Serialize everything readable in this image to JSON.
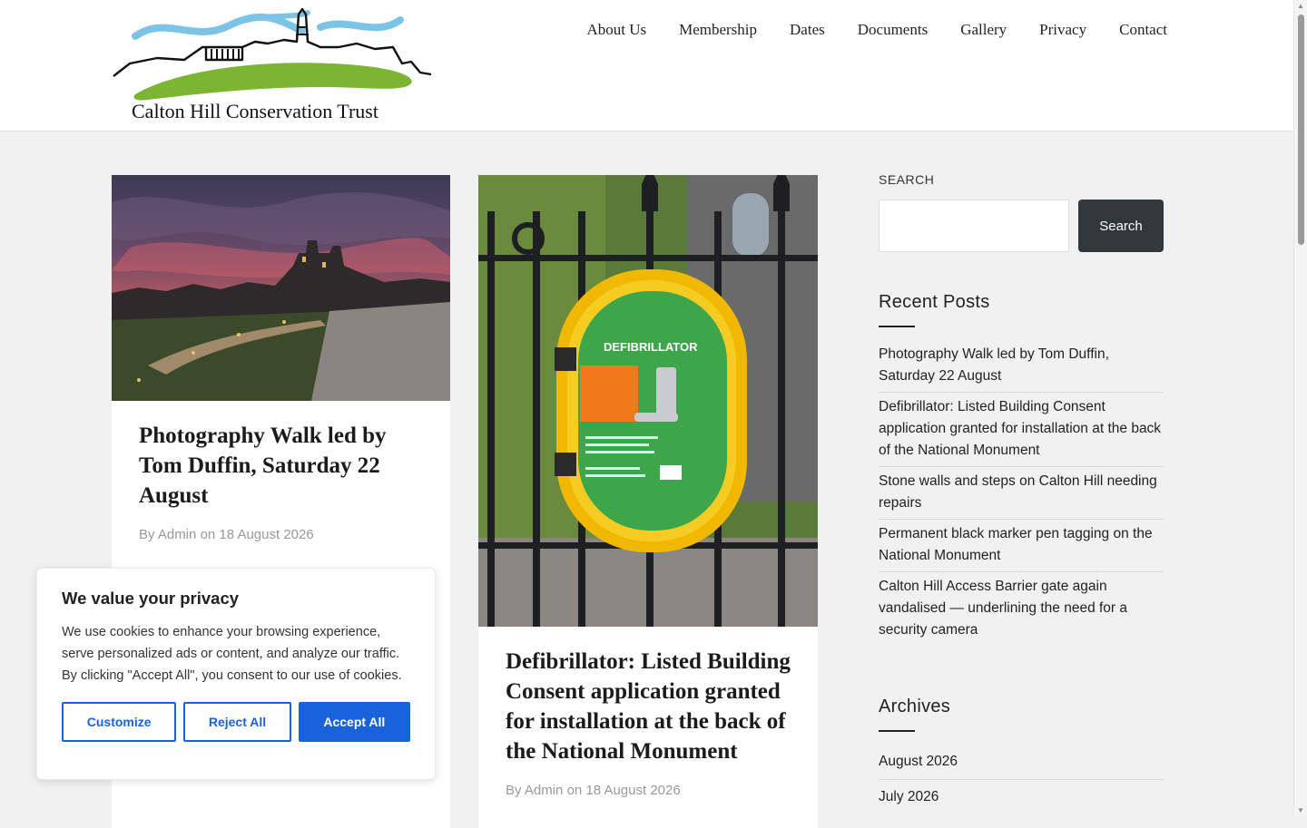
{
  "header": {
    "logo_text": "Calton Hill Conservation Trust",
    "nav": [
      {
        "label": "About Us"
      },
      {
        "label": "Membership"
      },
      {
        "label": "Dates"
      },
      {
        "label": "Documents"
      },
      {
        "label": "Gallery"
      },
      {
        "label": "Privacy"
      },
      {
        "label": "Contact"
      }
    ]
  },
  "posts": [
    {
      "title": "Photography Walk led by Tom Duffin, Saturday 22 August",
      "meta_by": "By",
      "author": "Admin",
      "meta_on": "on",
      "date": "18 August 2026",
      "image": "sunset-calton-hill-photo"
    },
    {
      "title": "Defibrillator: Listed Building Consent application granted for installation at the back of the National Monument",
      "meta_by": "By",
      "author": "Admin",
      "meta_on": "on",
      "date": "18 August 2026",
      "image": "defibrillator-on-railings-photo",
      "image_label": "DEFIBRILLATOR"
    }
  ],
  "sidebar": {
    "search": {
      "label": "SEARCH",
      "placeholder": "",
      "button_label": "Search"
    },
    "recent_posts": {
      "title": "Recent Posts",
      "items": [
        "Photography Walk led by Tom Duffin, Saturday 22 August",
        "Defibrillator: Listed Building Consent application granted for installation at the back of the National Monument",
        "Stone walls and steps on Calton Hill needing repairs",
        "Permanent black marker pen tagging on the National Monument",
        "Calton Hill Access Barrier gate again vandalised — underlining the need for a security camera"
      ]
    },
    "archives": {
      "title": "Archives",
      "items": [
        "August 2026",
        "July 2026"
      ]
    }
  },
  "cookie_banner": {
    "title": "We value your privacy",
    "text": "We use cookies to enhance your browsing experience, serve personalized ads or content, and analyze our traffic. By clicking \"Accept All\", you consent to our use of cookies.",
    "customize_label": "Customize",
    "reject_label": "Reject All",
    "accept_label": "Accept All"
  },
  "colors": {
    "accent_blue": "#1863dc",
    "search_button": "#32373c",
    "logo_green": "#7cb532",
    "logo_sky": "#7cc4e6",
    "defib_yellow": "#f2c200",
    "defib_green": "#3ea64a"
  }
}
